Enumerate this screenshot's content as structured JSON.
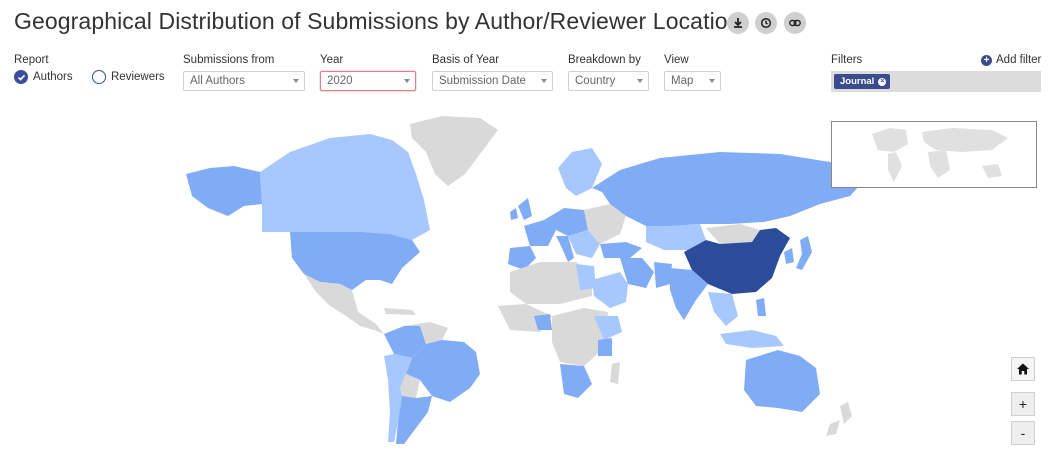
{
  "header": {
    "title": "Geographical Distribution of Submissions by Author/Reviewer Location"
  },
  "toolbar": {
    "download_icon": "download-icon",
    "reset_icon": "history-icon",
    "link_icon": "link-icon"
  },
  "report": {
    "label": "Report",
    "options": [
      {
        "label": "Authors",
        "selected": true
      },
      {
        "label": "Reviewers",
        "selected": false
      }
    ]
  },
  "submissions_from": {
    "label": "Submissions from",
    "value": "All Authors"
  },
  "year": {
    "label": "Year",
    "value": "2020"
  },
  "basis": {
    "label": "Basis of Year",
    "value": "Submission Date"
  },
  "breakdown": {
    "label": "Breakdown by",
    "value": "Country"
  },
  "view": {
    "label": "View",
    "value": "Map"
  },
  "filters": {
    "label": "Filters",
    "add_label": "Add filter",
    "chips": [
      {
        "label": "Journal"
      }
    ]
  },
  "map_controls": {
    "home_icon": "home-icon",
    "zoom_in": "+",
    "zoom_out": "-"
  },
  "colors": {
    "accent": "#3b4c8e",
    "no_data": "#d9d9d9",
    "light": "#a6c8ff",
    "mid": "#80abf5",
    "dark": "#2a4c9a"
  }
}
